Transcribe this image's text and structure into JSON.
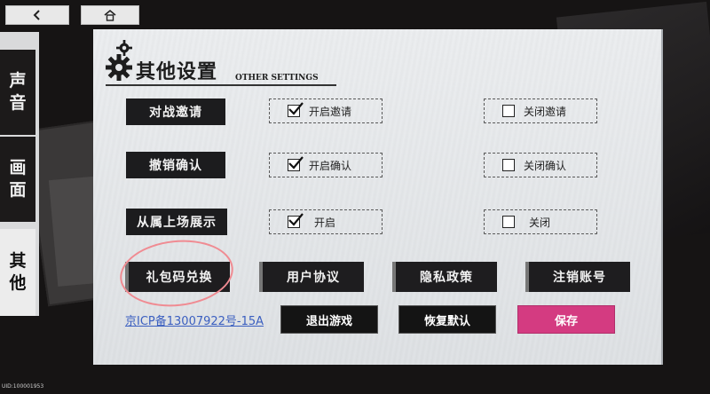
{
  "nav": {
    "back_icon": "back-chevron-icon",
    "home_icon": "home-icon"
  },
  "tabs": [
    {
      "char1": "声",
      "char2": "音"
    },
    {
      "char1": "画",
      "char2": "面"
    },
    {
      "char1": "其",
      "char2": "他"
    }
  ],
  "panel": {
    "title": "其他设置",
    "subtitle": "OTHER SETTINGS",
    "rows": [
      {
        "label": "对战邀请",
        "on_label": "开启邀请",
        "off_label": "关闭邀请",
        "on_checked": true,
        "off_checked": false
      },
      {
        "label": "撤销确认",
        "on_label": "开启确认",
        "off_label": "关闭确认",
        "on_checked": true,
        "off_checked": false
      },
      {
        "label": "从属上场展示",
        "on_label": "开启",
        "off_label": "关闭",
        "on_checked": true,
        "off_checked": false
      }
    ],
    "actions": {
      "gift_code": "礼包码兑换",
      "user_agreement": "用户协议",
      "privacy_policy": "隐私政策",
      "cancel_account": "注销账号"
    },
    "icp": "京ICP备13007922号-15A",
    "bottom": {
      "exit": "退出游戏",
      "reset": "恢复默认",
      "save": "保存"
    }
  },
  "uid": "UID:100001953",
  "colors": {
    "save": "#d43b81",
    "highlight": "#f08b92",
    "link": "#3b5fc0"
  }
}
